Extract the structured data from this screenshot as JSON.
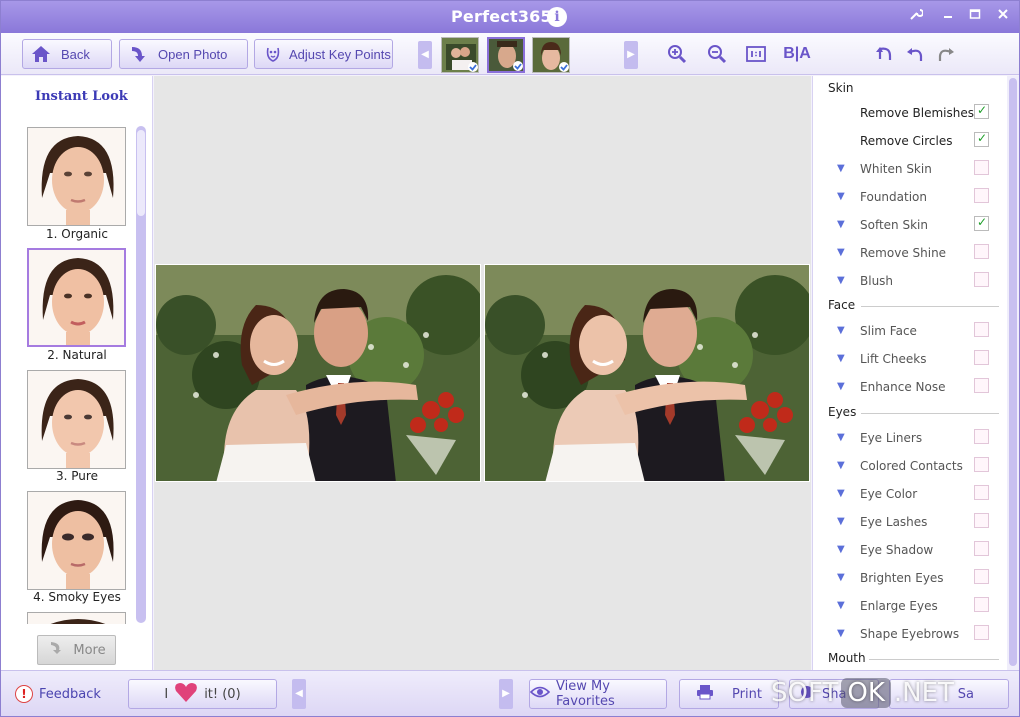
{
  "app": {
    "title": "Perfect365"
  },
  "toolbar": {
    "back_label": "Back",
    "open_label": "Open Photo",
    "adjust_label": "Adjust Key Points",
    "before_after_label": "B|A"
  },
  "left_panel": {
    "heading": "Instant Look",
    "looks": [
      {
        "label": "1. Organic"
      },
      {
        "label": "2. Natural"
      },
      {
        "label": "3. Pure"
      },
      {
        "label": "4. Smoky Eyes"
      }
    ],
    "more_label": "More"
  },
  "right_panel": {
    "sections": [
      {
        "title": "Skin",
        "items": [
          {
            "name": "Remove Blemishes",
            "checked": true,
            "expandable": false
          },
          {
            "name": "Remove Circles",
            "checked": true,
            "expandable": false
          },
          {
            "name": "Whiten Skin",
            "checked": false,
            "expandable": true
          },
          {
            "name": "Foundation",
            "checked": false,
            "expandable": true
          },
          {
            "name": "Soften Skin",
            "checked": true,
            "expandable": true
          },
          {
            "name": "Remove Shine",
            "checked": false,
            "expandable": true
          },
          {
            "name": "Blush",
            "checked": false,
            "expandable": true
          }
        ]
      },
      {
        "title": "Face",
        "items": [
          {
            "name": "Slim Face",
            "checked": false,
            "expandable": true
          },
          {
            "name": "Lift Cheeks",
            "checked": false,
            "expandable": true
          },
          {
            "name": "Enhance Nose",
            "checked": false,
            "expandable": true
          }
        ]
      },
      {
        "title": "Eyes",
        "items": [
          {
            "name": "Eye Liners",
            "checked": false,
            "expandable": true
          },
          {
            "name": "Colored Contacts",
            "checked": false,
            "expandable": true
          },
          {
            "name": "Eye Color",
            "checked": false,
            "expandable": true
          },
          {
            "name": "Eye Lashes",
            "checked": false,
            "expandable": true
          },
          {
            "name": "Eye Shadow",
            "checked": false,
            "expandable": true
          },
          {
            "name": "Brighten Eyes",
            "checked": false,
            "expandable": true
          },
          {
            "name": "Enlarge Eyes",
            "checked": false,
            "expandable": true
          },
          {
            "name": "Shape Eyebrows",
            "checked": false,
            "expandable": true
          }
        ]
      },
      {
        "title": "Mouth",
        "items": []
      }
    ]
  },
  "bottom": {
    "feedback_label": "Feedback",
    "love_prefix": "I",
    "love_suffix": "it! (0)",
    "favorites_label": "View My Favorites",
    "print_label": "Print",
    "share_label": "Sha",
    "save_label": "Sa"
  },
  "watermark": {
    "left": "SOFT",
    "ok": "OK",
    "right": ".NET"
  },
  "colors": {
    "accent": "#8a78d9",
    "check": "#1e9e2a",
    "link": "#4b45b0"
  }
}
